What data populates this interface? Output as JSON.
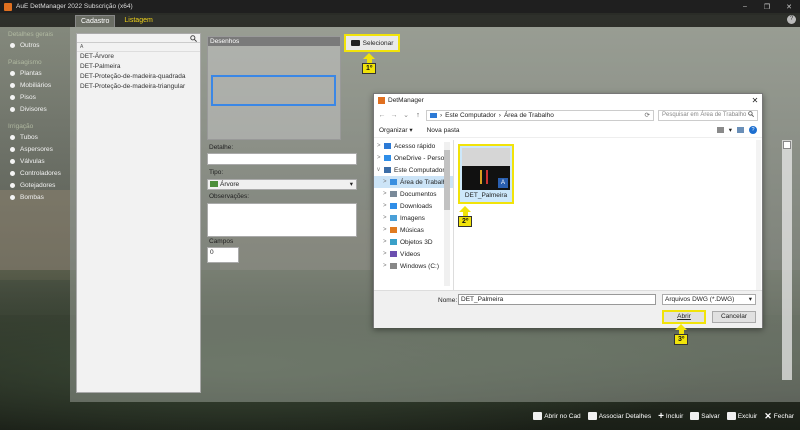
{
  "window": {
    "title": "AuE DetManager 2022 Subscrição (x64)",
    "controls": [
      "–",
      "❐",
      "✕"
    ],
    "help": "?"
  },
  "tabs": [
    {
      "label": "Cadastro"
    },
    {
      "label": "Listagem"
    }
  ],
  "sidebar": {
    "sections": [
      {
        "label": "Detalhes gerais",
        "items": [
          "Outros"
        ]
      },
      {
        "label": "Paisagismo",
        "items": [
          "Plantas",
          "Mobiliários",
          "Pisos",
          "Divisores"
        ]
      },
      {
        "label": "Irrigação",
        "items": [
          "Tubos",
          "Aspersores",
          "Válvulas",
          "Controladores",
          "Gotejadores",
          "Bombas"
        ]
      }
    ]
  },
  "list": {
    "column_label": "A",
    "items": [
      "DET-Árvore",
      "DET-Palmeira",
      "DET-Proteção-de-madeira-quadrada",
      "DET-Proteção-de-madeira-triangular"
    ]
  },
  "form": {
    "desenhos_label": "Desenhos",
    "select_button": "Selecionar",
    "detalhe_label": "Detalhe:",
    "tipo_label": "Tipo:",
    "tipo_value": "Árvore",
    "observacoes_label": "Observações:",
    "campos_label": "Campos",
    "campos_value": "0"
  },
  "callouts": {
    "first": "1º",
    "second": "2º",
    "third": "3º"
  },
  "dialog": {
    "title": "DetManager",
    "close": "✕",
    "address": {
      "part1": "Este Computador",
      "sep": "›",
      "part2": "Área de Trabalho"
    },
    "search_placeholder": "Pesquisar em Área de Trabalho",
    "organize": "Organizar ▾",
    "new_folder": "Nova pasta",
    "nav_items": [
      {
        "label": "Acesso rápido",
        "color": "#2c7ad6"
      },
      {
        "label": "OneDrive - Person",
        "color": "#2f8ee8"
      },
      {
        "label": "Este Computador",
        "color": "#3c6ea8"
      },
      {
        "label": "Área de Trabalho",
        "color": "#3a8fe0"
      },
      {
        "label": "Documentos",
        "color": "#7a8a99"
      },
      {
        "label": "Downloads",
        "color": "#2f8ee8"
      },
      {
        "label": "Imagens",
        "color": "#4aa0d8"
      },
      {
        "label": "Músicas",
        "color": "#e07b20"
      },
      {
        "label": "Objetos 3D",
        "color": "#3aa0c8"
      },
      {
        "label": "Vídeos",
        "color": "#6c4fb0"
      },
      {
        "label": "Windows (C:)",
        "color": "#888888"
      }
    ],
    "file": {
      "name": "DET_Palmeira"
    },
    "name_label": "Nome:",
    "name_value": "DET_Palmeira",
    "filetype": "Arquivos DWG (*.DWG)",
    "open_button": "Abrir",
    "cancel_button": "Cancelar"
  },
  "actions": [
    "Abrir no Cad",
    "Associar Detalhes",
    "Incluir",
    "Salvar",
    "Excluir",
    "Fechar"
  ],
  "colors": {
    "highlight": "#f1e30a",
    "selection": "#3a87e6",
    "tab_text": "#f0d21a"
  }
}
